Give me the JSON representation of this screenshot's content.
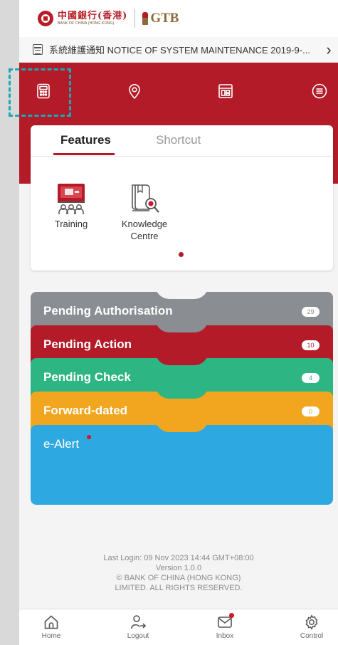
{
  "brand": {
    "bank_name_cn": "中國銀行(香港)",
    "bank_name_en": "BANK OF CHINA (HONG KONG)",
    "product": "GTB"
  },
  "notice": {
    "text": "系統維護通知 NOTICE OF SYSTEM MAINTENANCE 2019-9-...",
    "chevron": "›"
  },
  "quick_icons": [
    "calculator-icon",
    "location-pin-icon",
    "dashboard-icon",
    "menu-icon"
  ],
  "features_card": {
    "tabs": [
      {
        "label": "Features",
        "active": true
      },
      {
        "label": "Shortcut",
        "active": false
      }
    ],
    "items": [
      {
        "label": "Training",
        "icon": "training-icon"
      },
      {
        "label": "Knowledge Centre",
        "icon": "knowledge-centre-icon"
      }
    ]
  },
  "pending": [
    {
      "label": "Pending Authorisation",
      "count": "29",
      "color": "#8a8d92"
    },
    {
      "label": "Pending Action",
      "count": "10",
      "color": "#b31b28"
    },
    {
      "label": "Pending Check",
      "count": "4",
      "color": "#2db584"
    },
    {
      "label": "Forward-dated",
      "count": "0",
      "color": "#f2a51f"
    },
    {
      "label": "e-Alert",
      "color": "#2ea8e0"
    }
  ],
  "footer_info": {
    "last_login": "Last Login: 09 Nov 2023 14:44 GMT+08:00",
    "version": "Version 1.0.0",
    "copyright_1": "© BANK OF CHINA (HONG KONG)",
    "copyright_2": "LIMITED. ALL RIGHTS RESERVED."
  },
  "bottom_nav": [
    {
      "label": "Home",
      "icon": "home-icon"
    },
    {
      "label": "Logout",
      "icon": "logout-icon"
    },
    {
      "label": "Inbox",
      "icon": "inbox-icon"
    },
    {
      "label": "Control",
      "icon": "gear-icon"
    }
  ],
  "colors": {
    "brand_red": "#b31b28",
    "selection_outline": "#1aa8b7"
  }
}
